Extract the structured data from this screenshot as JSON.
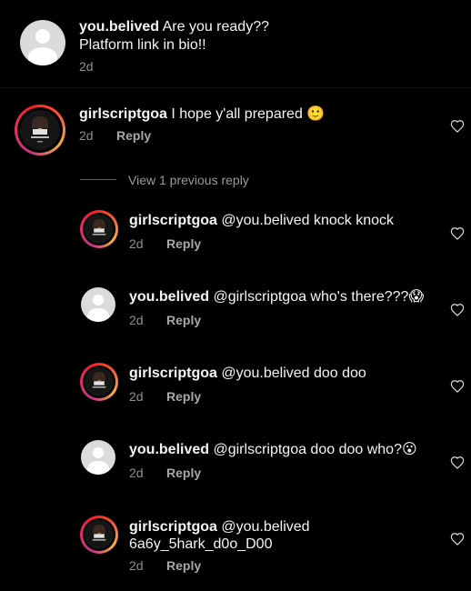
{
  "top_comment": {
    "username": "you.belived",
    "text_line1": "Are you ready??",
    "text_line2": "Platform link in bio!!",
    "time": "2d"
  },
  "main_comment": {
    "username": "girlscriptgoa",
    "text": "I hope y'all prepared 🙂",
    "time": "2d",
    "reply_label": "Reply"
  },
  "view_replies_label": "View 1 previous reply",
  "replies": [
    {
      "username": "girlscriptgoa",
      "text": "@you.belived knock knock",
      "time": "2d",
      "reply_label": "Reply"
    },
    {
      "username": "you.belived",
      "text": "@girlscriptgoa who's there???😱",
      "time": "2d",
      "reply_label": "Reply"
    },
    {
      "username": "girlscriptgoa",
      "text": "@you.belived doo doo",
      "time": "2d",
      "reply_label": "Reply"
    },
    {
      "username": "you.belived",
      "text": "@girlscriptgoa doo doo who?😮",
      "time": "2d",
      "reply_label": "Reply"
    },
    {
      "username": "girlscriptgoa",
      "text_line1": "@you.belived",
      "text_line2": "6a6y_5hark_d0o_D00",
      "time": "2d",
      "reply_label": "Reply"
    }
  ]
}
